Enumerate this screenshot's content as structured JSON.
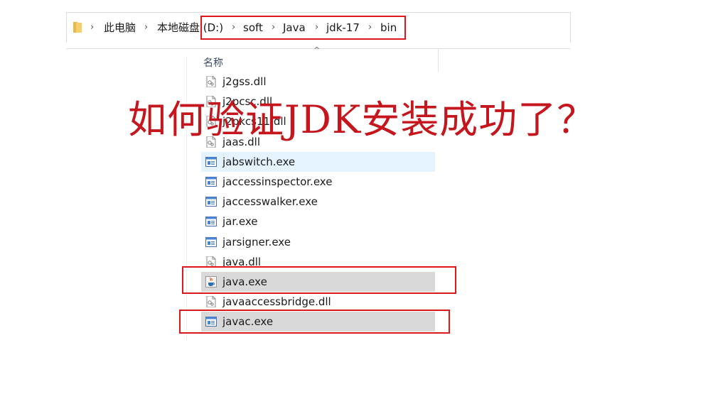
{
  "breadcrumb": {
    "items": [
      "此电脑",
      "本地磁盘 (D:)",
      "soft",
      "Java",
      "jdk-17",
      "bin"
    ]
  },
  "file_list": {
    "column_header": "名称",
    "files": [
      {
        "name": "j2gss.dll",
        "icon": "dll-file-icon"
      },
      {
        "name": "j2pcsc.dll",
        "icon": "dll-file-icon"
      },
      {
        "name": "j2pkcs11.dll",
        "icon": "dll-file-icon"
      },
      {
        "name": "jaas.dll",
        "icon": "dll-file-icon"
      },
      {
        "name": "jabswitch.exe",
        "icon": "exe-window-icon",
        "state": "hover"
      },
      {
        "name": "jaccessinspector.exe",
        "icon": "exe-window-icon"
      },
      {
        "name": "jaccesswalker.exe",
        "icon": "exe-window-icon"
      },
      {
        "name": "jar.exe",
        "icon": "exe-window-icon"
      },
      {
        "name": "jarsigner.exe",
        "icon": "exe-window-icon"
      },
      {
        "name": "java.dll",
        "icon": "dll-file-icon"
      },
      {
        "name": "java.exe",
        "icon": "java-coffee-icon",
        "state": "selected",
        "highlighted": true
      },
      {
        "name": "javaaccessbridge.dll",
        "icon": "dll-file-icon"
      },
      {
        "name": "javac.exe",
        "icon": "exe-window-icon",
        "state": "selected",
        "highlighted": true
      }
    ]
  },
  "overlay_title": "如何验证JDK安装成功了？",
  "colors": {
    "highlight_border": "#e0161d",
    "overlay_text": "#c5161d",
    "hover_row": "#e5f3ff",
    "selected_row": "#d9d9d9"
  }
}
